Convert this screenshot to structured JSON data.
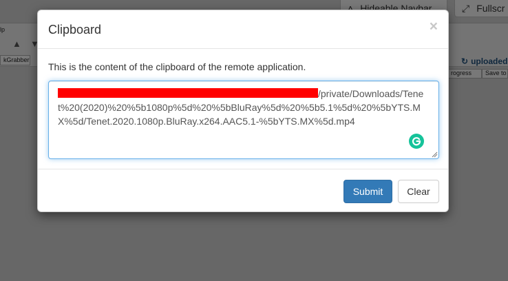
{
  "background": {
    "nav_button_label": "Hideable Navbar",
    "fullscreen_button_label": "Fullscr",
    "menu_fragment": "lp",
    "tab_grabber": "kGrabber",
    "right_brand": "uploaded",
    "col_progress": "rogress",
    "col_save": "Save to"
  },
  "modal": {
    "title": "Clipboard",
    "close_glyph": "×",
    "description": "This is the content of the clipboard of the remote application.",
    "clipboard_visible_text": "/private/Downloads/Tenet%20(2020)%20%5b1080p%5d%20%5bBluRay%5d%20%5b5.1%5d%20%5bYTS.MX%5d/Tenet.2020.1080p.BluRay.x264.AAC5.1-%5bYTS.MX%5d.mp4",
    "redaction_color": "#ff0000",
    "submit_label": "Submit",
    "clear_label": "Clear"
  },
  "colors": {
    "primary": "#337ab7",
    "grammarly": "#15c39a",
    "focus_border": "#66afe9"
  }
}
